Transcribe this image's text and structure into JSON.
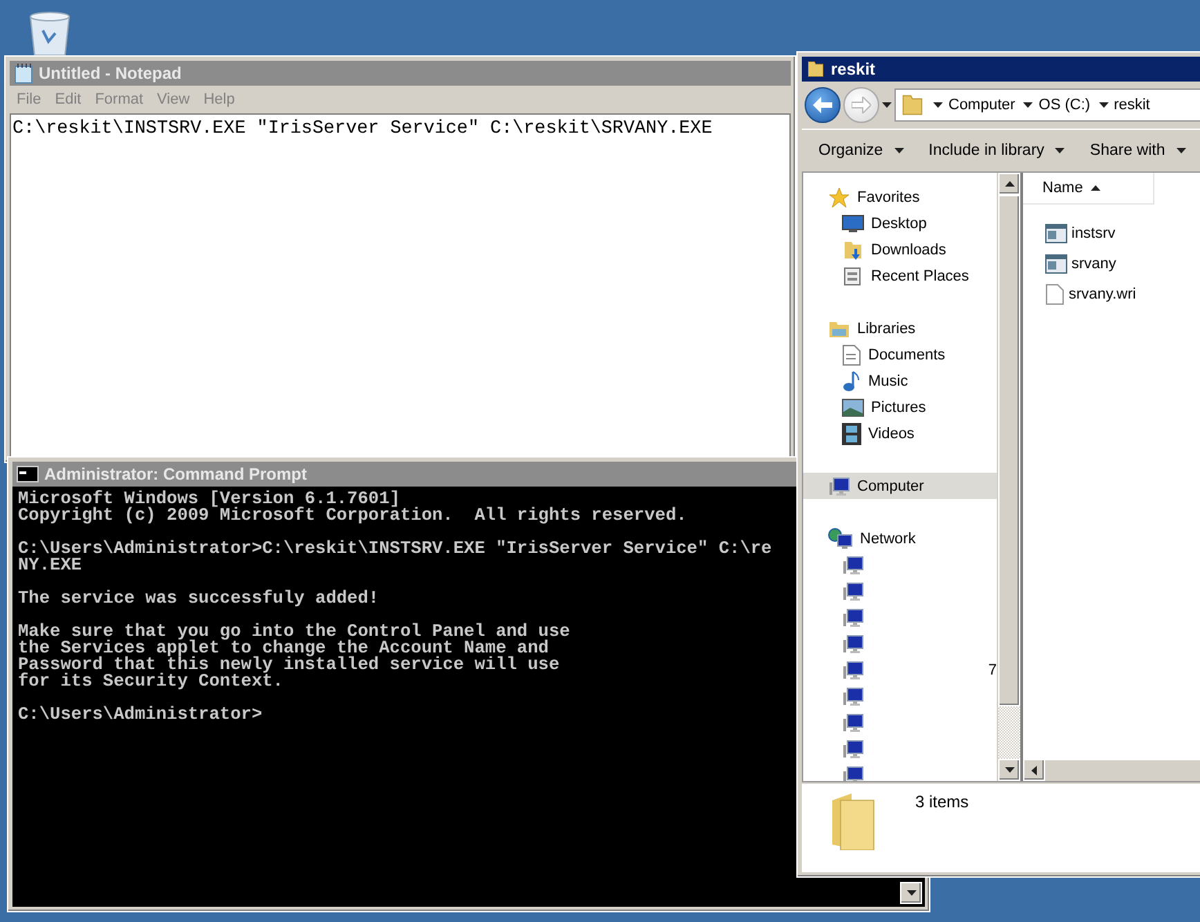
{
  "notepad": {
    "title": "Untitled - Notepad",
    "active": false,
    "menu": [
      "File",
      "Edit",
      "Format",
      "View",
      "Help"
    ],
    "text": "C:\\reskit\\INSTSRV.EXE \"IrisServer Service\" C:\\reskit\\SRVANY.EXE"
  },
  "command_prompt": {
    "title": "Administrator: Command Prompt",
    "active": false,
    "blocks": [
      [
        "Microsoft Windows [Version 6.1.7601]",
        "Copyright (c) 2009 Microsoft Corporation.  All rights reserved."
      ],
      [
        "C:\\Users\\Administrator>C:\\reskit\\INSTSRV.EXE \"IrisServer Service\" C:\\re",
        "NY.EXE"
      ],
      [
        "The service was successfuly added!"
      ],
      [
        "Make sure that you go into the Control Panel and use",
        "the Services applet to change the Account Name and",
        "Password that this newly installed service will use",
        "for its Security Context."
      ],
      [
        "C:\\Users\\Administrator>"
      ]
    ]
  },
  "explorer": {
    "title": "reskit",
    "active": true,
    "breadcrumbs": [
      "Computer",
      "OS (C:)",
      "reskit"
    ],
    "toolbar": [
      "Organize",
      "Include in library",
      "Share with"
    ],
    "nav": [
      {
        "label": "Favorites",
        "kind": "star",
        "selected": false,
        "children": [
          {
            "label": "Desktop",
            "kind": "desktop",
            "selected": false
          },
          {
            "label": "Downloads",
            "kind": "downloads",
            "selected": false
          },
          {
            "label": "Recent Places",
            "kind": "recent",
            "selected": false
          }
        ]
      },
      {
        "label": "Libraries",
        "kind": "library",
        "selected": false,
        "children": [
          {
            "label": "Documents",
            "kind": "document",
            "selected": false
          },
          {
            "label": "Music",
            "kind": "music",
            "selected": false
          },
          {
            "label": "Pictures",
            "kind": "picture",
            "selected": false
          },
          {
            "label": "Videos",
            "kind": "video",
            "selected": false
          }
        ]
      },
      {
        "label": "Computer",
        "kind": "computer",
        "selected": true
      },
      {
        "label": "Network",
        "kind": "network",
        "selected": false,
        "children": [
          {
            "kind": "computer",
            "selected": false
          },
          {
            "kind": "computer",
            "selected": false
          },
          {
            "kind": "computer",
            "selected": false
          },
          {
            "kind": "computer",
            "selected": false
          },
          {
            "label": "7",
            "kind": "computer",
            "selected": false
          },
          {
            "kind": "computer",
            "selected": false
          },
          {
            "kind": "computer",
            "selected": false
          },
          {
            "kind": "computer",
            "selected": false
          },
          {
            "kind": "computer",
            "selected": false
          }
        ]
      }
    ],
    "column": "Name",
    "files": [
      {
        "name": "instsrv",
        "kind": "app"
      },
      {
        "name": "srvany",
        "kind": "app"
      },
      {
        "name": "srvany.wri",
        "kind": "document"
      }
    ],
    "status": "3 items"
  }
}
